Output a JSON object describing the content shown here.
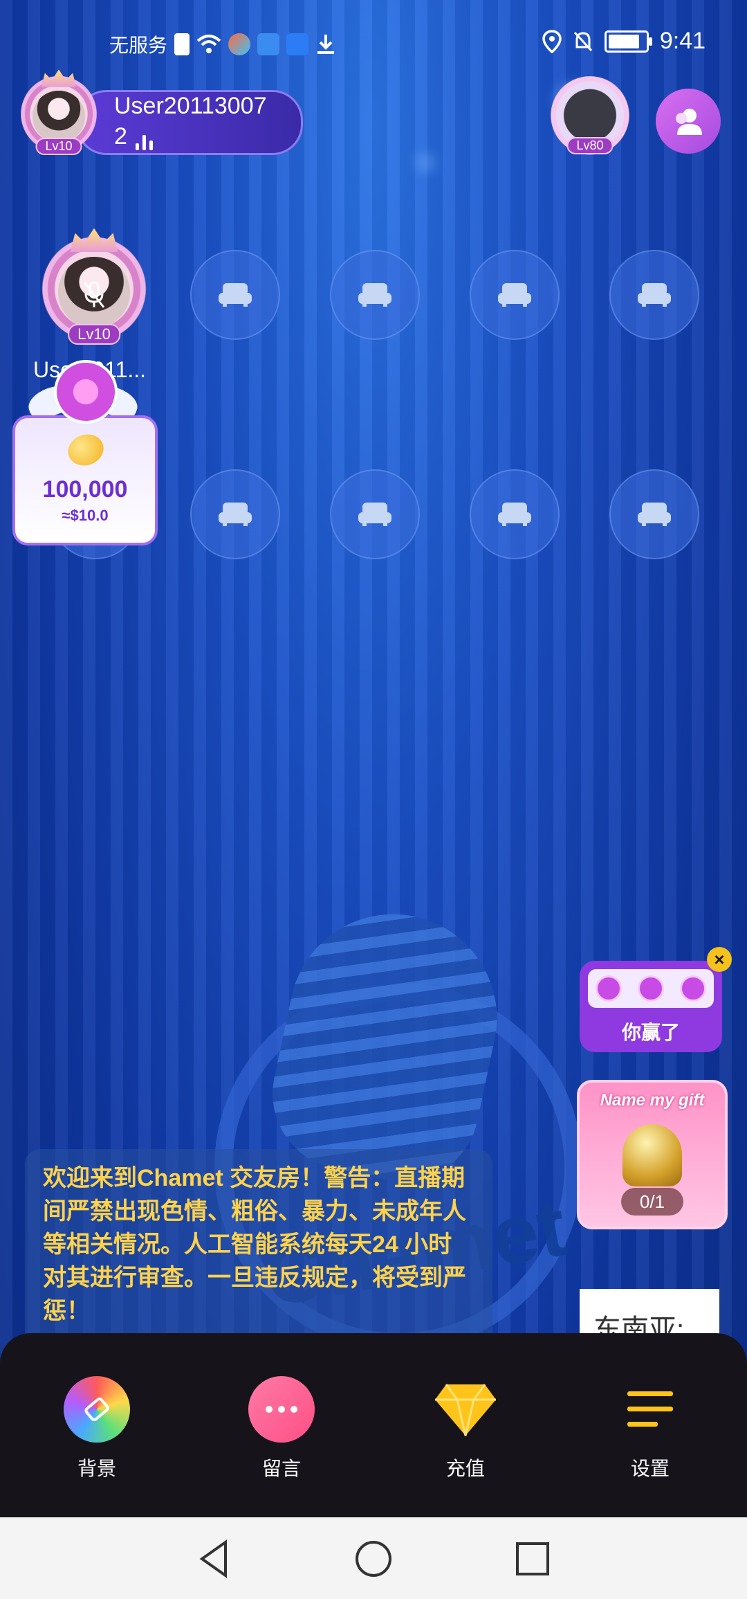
{
  "status_bar": {
    "carrier": "无服务",
    "time": "9:41",
    "battery_level": 0.85
  },
  "host": {
    "name": "User20113007",
    "listeners": "2",
    "level": "Lv10"
  },
  "top_right": {
    "frame_level": "Lv80"
  },
  "seats": {
    "host_seat_name": "User2011...",
    "host_seat_level": "Lv10"
  },
  "gift_popup": {
    "amount": "100,000",
    "usd": "≈$10.0"
  },
  "notice": {
    "text": "欢迎来到Chamet 交友房！警告：直播期间严禁出现色情、粗俗、暴力、未成年人等相关情况。人工智能系统每天24 小时对其进行审查。一旦违反规定，将受到严惩！"
  },
  "widgets": {
    "win_label": "你赢了",
    "name_gift_title": "Name my gift",
    "name_gift_progress": "0/1",
    "region_text": "东南亚:"
  },
  "bottom_bar": {
    "items": [
      {
        "label": "背景",
        "icon": "palette-icon"
      },
      {
        "label": "留言",
        "icon": "chat-icon"
      },
      {
        "label": "充值",
        "icon": "diamond-icon"
      },
      {
        "label": "设置",
        "icon": "menu-icon"
      }
    ]
  },
  "background_word": "Chamet",
  "colors": {
    "accent_purple": "#8e3ae0",
    "notice_text": "#ffd24a",
    "background_blue": "#1a4fc6"
  }
}
